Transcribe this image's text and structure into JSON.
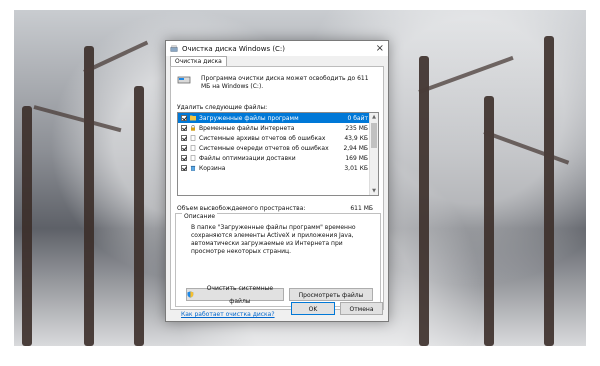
{
  "window": {
    "title": "Очистка диска Windows (C:)"
  },
  "tabs": [
    {
      "label": "Очистка диска"
    }
  ],
  "info": "Программа очистки диска может освободить до 611 МБ на Windows (C:).",
  "list_label": "Удалить следующие файлы:",
  "files": [
    {
      "name": "Загруженные файлы программ",
      "size": "0 байт",
      "checked": true,
      "selected": true,
      "icon": "folder-icon"
    },
    {
      "name": "Временные файлы Интернета",
      "size": "235 МБ",
      "checked": true,
      "selected": false,
      "icon": "lock-icon"
    },
    {
      "name": "Системные архивы отчетов об ошибках",
      "size": "43,9 КБ",
      "checked": true,
      "selected": false,
      "icon": "file-icon"
    },
    {
      "name": "Системные очереди отчетов об ошибках",
      "size": "2,94 МБ",
      "checked": true,
      "selected": false,
      "icon": "file-icon"
    },
    {
      "name": "Файлы оптимизации доставки",
      "size": "169 МБ",
      "checked": true,
      "selected": false,
      "icon": "file-icon"
    },
    {
      "name": "Корзина",
      "size": "3,01 КБ",
      "checked": true,
      "selected": false,
      "icon": "recycle-bin-icon"
    }
  ],
  "total": {
    "label": "Объем высвобождаемого пространства:",
    "value": "611 МБ"
  },
  "description": {
    "legend": "Описание",
    "text": "В папке \"Загруженные файлы программ\" временно сохраняются элементы ActiveX и приложения Java, автоматически загружаемые из Интернета при просмотре некоторых страниц."
  },
  "buttons": {
    "clean_system": "Очистить системные файлы",
    "view_files": "Просмотреть файлы",
    "ok": "OK",
    "cancel": "Отмена"
  },
  "link": "Как работает очистка диска?",
  "colors": {
    "selection": "#0078d7",
    "link": "#0066cc"
  }
}
